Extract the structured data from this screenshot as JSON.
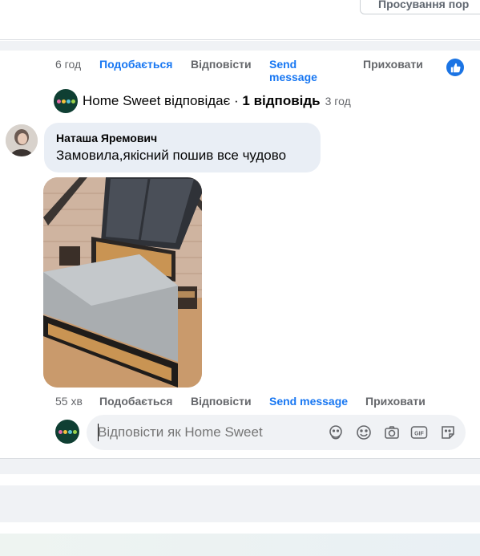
{
  "header": {
    "promote_label": "Просування пор"
  },
  "first_comment_actions": {
    "time": "6 год",
    "like": "Подобається",
    "reply": "Відповісти",
    "send_message": "Send message",
    "hide": "Приховати"
  },
  "replies_summary": {
    "prefix": "Home Sweet відповідає · ",
    "count": "1 відповідь",
    "time": "3 год"
  },
  "comment": {
    "author": "Наташа Яремович",
    "text": "Замовила,якісний пошив все чудово",
    "time": "55 хв",
    "like": "Подобається",
    "reply": "Відповісти",
    "send_message": "Send message",
    "hide": "Приховати"
  },
  "composer": {
    "placeholder": "Відповісти як Home Sweet",
    "icons": [
      "avatar-sticker-icon",
      "emoji-icon",
      "camera-icon",
      "gif-icon",
      "sticker-icon"
    ]
  },
  "colors": {
    "accent": "#1877f2",
    "muted": "#65676b",
    "bubble": "#e9eef5",
    "logo_bg": "#0f3f33"
  }
}
